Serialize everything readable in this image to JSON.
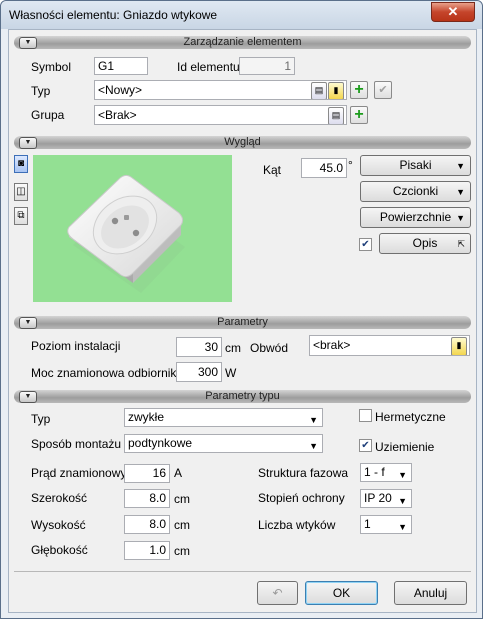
{
  "window": {
    "title": "Własności elementu: Gniazdo wtykowe",
    "close_glyph": "✕"
  },
  "sections": {
    "management": "Zarządzanie elementem",
    "appearance": "Wygląd",
    "parameters": "Parametry",
    "type_parameters": "Parametry typu"
  },
  "management": {
    "symbol_label": "Symbol",
    "symbol_value": "G1",
    "id_label": "Id elementu",
    "id_value": "1",
    "type_label": "Typ",
    "type_value": "<Nowy>",
    "group_label": "Grupa",
    "group_value": "<Brak>"
  },
  "appearance": {
    "angle_label": "Kąt",
    "angle_value": "45.0",
    "angle_unit": "°",
    "pens_button": "Pisaki",
    "fonts_button": "Czcionki",
    "surfaces_button": "Powierzchnie",
    "desc_button": "Opis",
    "desc_checked": true
  },
  "parameters": {
    "install_level_label": "Poziom instalacji",
    "install_level_value": "30",
    "install_level_unit": "cm",
    "circuit_label": "Obwód",
    "circuit_value": "<brak>",
    "rated_power_label": "Moc znamionowa odbiornika",
    "rated_power_value": "300",
    "rated_power_unit": "W"
  },
  "type_parameters": {
    "type_label": "Typ",
    "type_value": "zwykłe",
    "mount_label": "Sposób montażu",
    "mount_value": "podtynkowe",
    "hermetic_label": "Hermetyczne",
    "hermetic_checked": false,
    "grounding_label": "Uziemienie",
    "grounding_checked": true,
    "current_label": "Prąd znamionowy",
    "current_value": "16",
    "current_unit": "A",
    "width_label": "Szerokość",
    "width_value": "8.0",
    "width_unit": "cm",
    "height_label": "Wysokość",
    "height_value": "8.0",
    "height_unit": "cm",
    "depth_label": "Głębokość",
    "depth_value": "1.0",
    "depth_unit": "cm",
    "phase_label": "Struktura fazowa",
    "phase_value": "1 - f",
    "protection_label": "Stopień ochrony",
    "protection_value": "IP 20",
    "plugs_label": "Liczba wtyków",
    "plugs_value": "1"
  },
  "footer": {
    "ok_button": "OK",
    "cancel_button": "Anuluj"
  }
}
